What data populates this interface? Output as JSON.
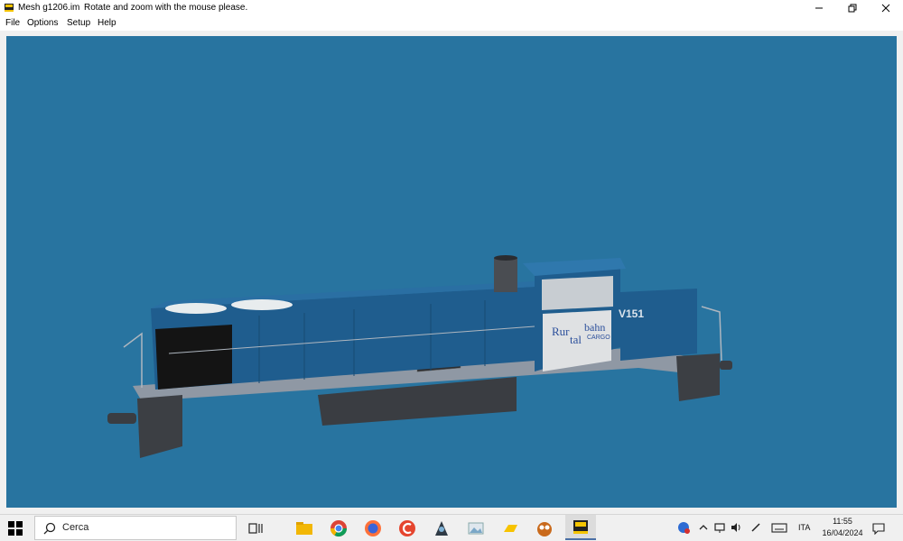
{
  "window": {
    "file_name": "Mesh g1206.im",
    "message": "Rotate and zoom with the mouse please."
  },
  "menu": [
    "File",
    "Options",
    "Setup",
    "Help"
  ],
  "model": {
    "number": "V151",
    "logo_rur": "Rur",
    "logo_tal": "tal",
    "logo_bahn": "bahn",
    "logo_cargo": "CARGO"
  },
  "taskbar": {
    "search_placeholder": "Cerca",
    "apps": [
      "task-view-icon",
      "file-explorer-icon",
      "chrome-icon",
      "firefox-icon",
      "ccleaner-icon",
      "game-character-icon",
      "image-viewer-icon",
      "cloud-drive-icon",
      "owl-app-icon",
      "locomotive-app-icon"
    ],
    "language": "ITA",
    "time": "11:55",
    "date": "16/04/2024"
  },
  "colors": {
    "viewport_bg": "#2874a0",
    "loco_body": "#1f5d8e",
    "taskbar_bg": "#f0f0f0"
  }
}
